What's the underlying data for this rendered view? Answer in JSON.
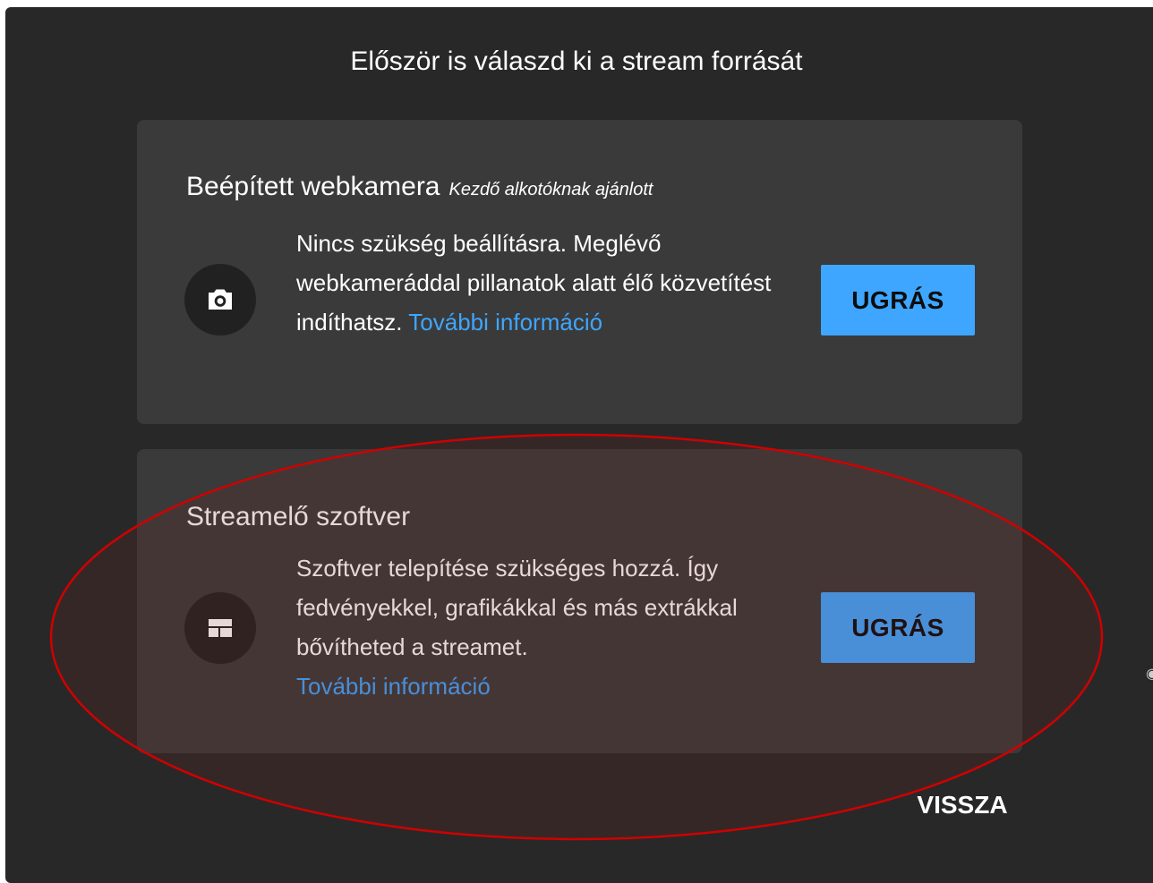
{
  "dialog": {
    "title": "Először is válaszd ki a stream forrását",
    "back_label": "VISSZA"
  },
  "sources": [
    {
      "heading": "Beépített webkamera",
      "tag": "Kezdő alkotóknak ajánlott",
      "icon": "camera-icon",
      "description": "Nincs szükség beállításra. Meglévő webkameráddal pillanatok alatt élő közvetítést indíthatsz.",
      "link_label": "További információ",
      "button_label": "UGRÁS"
    },
    {
      "heading": "Streamelő szoftver",
      "icon": "layout-icon",
      "description": "Szoftver telepítése szükséges hozzá. Így fedvényekkel, grafikákkal és más extrákkal bővítheted a streamet.",
      "link_label": "További információ",
      "button_label": "UGRÁS"
    }
  ],
  "colors": {
    "accent": "#3ea6ff",
    "dialog_background": "#282828",
    "card_background": "#3a3a3a",
    "annotation": "#d00000"
  }
}
